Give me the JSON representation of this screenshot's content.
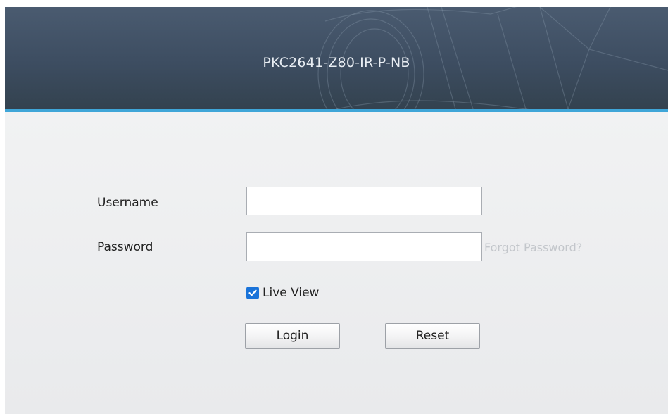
{
  "header": {
    "title": "PKC2641-Z80-IR-P-NB"
  },
  "form": {
    "username_label": "Username",
    "username_value": "",
    "password_label": "Password",
    "password_value": "",
    "forgot_password": "Forgot Password?",
    "live_view_label": "Live View",
    "live_view_checked": true
  },
  "buttons": {
    "login": "Login",
    "reset": "Reset"
  },
  "icons": {
    "checkbox": "check-icon"
  },
  "colors": {
    "header": "#3d4d61",
    "accent": "#3fa6d8",
    "checkbox": "#1a73d9"
  }
}
